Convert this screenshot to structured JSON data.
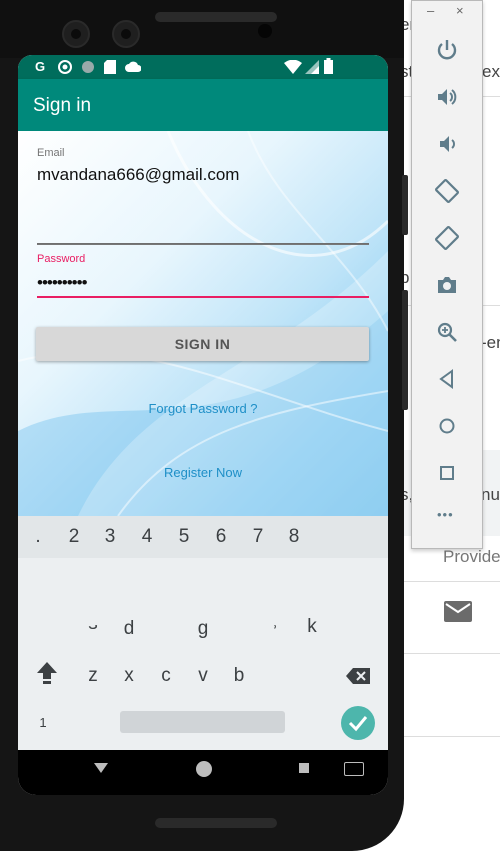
{
  "colors": {
    "primary": "#00897b",
    "primary_dark": "#006d5c",
    "accent": "#e91e63",
    "link": "#1e8fc7",
    "keyboard_bg": "#eceff1"
  },
  "status_bar": {
    "left_icons": [
      "google-icon",
      "chrome-icon",
      "circle-icon",
      "sd-card-icon",
      "cloud-icon"
    ],
    "right_icons": [
      "wifi-icon",
      "signal-icon",
      "battery-icon"
    ]
  },
  "app": {
    "title": "Sign in",
    "email": {
      "label": "Email",
      "value": "mvandana666@gmail.com"
    },
    "password": {
      "label": "Password",
      "value": "••••••••••"
    },
    "sign_in_label": "SIGN IN",
    "forgot_password_label": "Forgot Password ?",
    "register_label": "Register Now"
  },
  "keyboard": {
    "number_row": [
      ".",
      "2",
      "3",
      "4",
      "5",
      "6",
      "7",
      "8"
    ],
    "row_two": [
      "s",
      "d",
      "g",
      ",",
      "k"
    ],
    "row_three": [
      "z",
      "x",
      "c",
      "v",
      "b"
    ],
    "mode_key": "1"
  },
  "nav_bar": {
    "icons": [
      "back-icon",
      "home-icon",
      "recents-icon",
      "keyboard-switch-icon"
    ]
  },
  "emulator_toolbar": {
    "window_controls": [
      "–",
      "×"
    ],
    "icons": [
      "power-icon",
      "volume-up-icon",
      "volume-down-icon",
      "rotate-left-icon",
      "rotate-right-icon",
      "camera-icon",
      "zoom-icon",
      "back-icon",
      "home-icon",
      "overview-icon",
      "more-icon"
    ],
    "more_label": "•••"
  },
  "background_window": {
    "fragments": [
      "en/(",
      "st",
      "exp",
      "p",
      "t",
      "-en",
      "s,",
      "nu",
      "Provide"
    ],
    "mail_icon": "mail-icon"
  }
}
